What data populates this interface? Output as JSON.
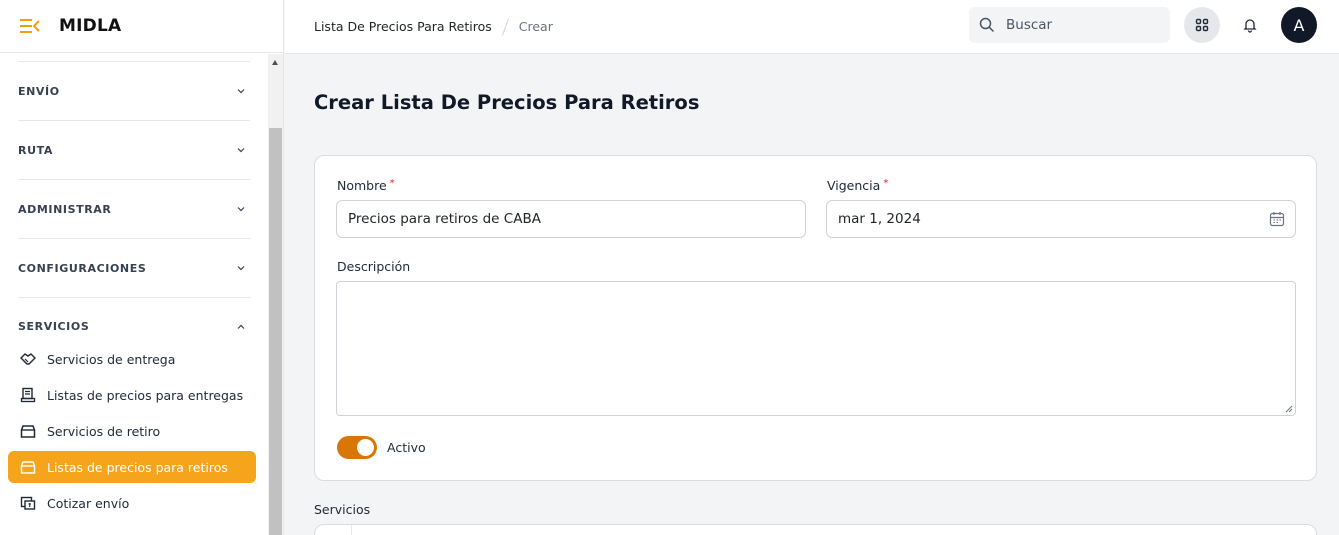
{
  "brand": {
    "name": "MIDLA"
  },
  "sidebar": {
    "groups": [
      {
        "label": "ENVÍO"
      },
      {
        "label": "RUTA"
      },
      {
        "label": "ADMINISTRAR"
      },
      {
        "label": "CONFIGURACIONES"
      },
      {
        "label": "SERVICIOS"
      }
    ],
    "items": [
      {
        "label": "Servicios de entrega",
        "icon": "handshake-icon"
      },
      {
        "label": "Listas de precios para entregas",
        "icon": "price-list-icon"
      },
      {
        "label": "Servicios de retiro",
        "icon": "box-icon"
      },
      {
        "label": "Listas de precios para retiros",
        "icon": "box-icon",
        "active": true
      },
      {
        "label": "Cotizar envío",
        "icon": "quote-icon"
      }
    ]
  },
  "header": {
    "breadcrumb": [
      "Lista De Precios Para Retiros",
      "Crear"
    ],
    "search_placeholder": "Buscar",
    "avatar_initial": "A"
  },
  "main": {
    "title": "Crear Lista De Precios Para Retiros",
    "form": {
      "nombre_label": "Nombre",
      "nombre_value": "Precios para retiros de CABA",
      "vigencia_label": "Vigencia",
      "vigencia_value": "mar 1, 2024",
      "descripcion_label": "Descripción",
      "required_mark": "*",
      "activo_label": "Activo",
      "activo_on": true
    },
    "servicios_label": "Servicios"
  },
  "colors": {
    "accent": "#f6a41b",
    "toggle": "#d97706",
    "avatar": "#111827"
  }
}
